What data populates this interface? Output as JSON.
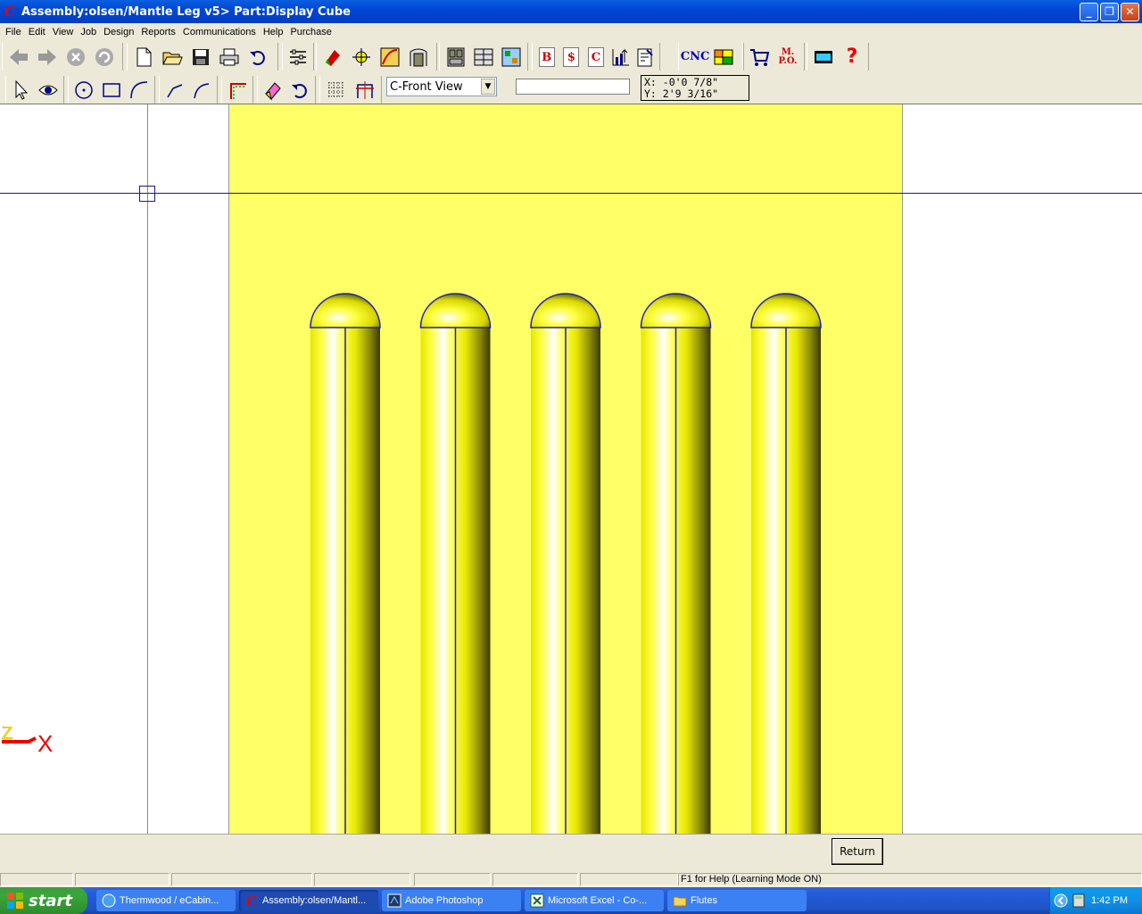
{
  "window": {
    "title": "Assembly:olsen/Mantle Leg v5> Part:Display Cube",
    "app_icon": "C"
  },
  "menu": [
    "File",
    "Edit",
    "View",
    "Job",
    "Design",
    "Reports",
    "Communications",
    "Help",
    "Purchase"
  ],
  "toolbar2": {
    "view_select": "C-Front View",
    "coord_x": "X: -0'0 7/8\"",
    "coord_y": "Y: 2'9 3/16\""
  },
  "toolbar1_labels": {
    "b": "B",
    "dollar": "$",
    "c": "C",
    "cnc": "CNC",
    "mpo_m": "M.",
    "mpo_po": "P.O.",
    "help": "?"
  },
  "canvas": {
    "axis_z": "Z",
    "axis_x": "X",
    "flute_count": 5,
    "panel_color": "#ffff66",
    "flute_color": "#ffff00"
  },
  "command": {
    "return_label": "Return"
  },
  "status": {
    "help_text": "F1 for Help (Learning Mode ON)"
  },
  "taskbar": {
    "start": "start",
    "tasks": [
      "Thermwood / eCabin...",
      "Assembly:olsen/Mantl...",
      "Adobe Photoshop",
      "Microsoft Excel - Co-...",
      "Flutes"
    ],
    "clock": "1:42 PM"
  }
}
